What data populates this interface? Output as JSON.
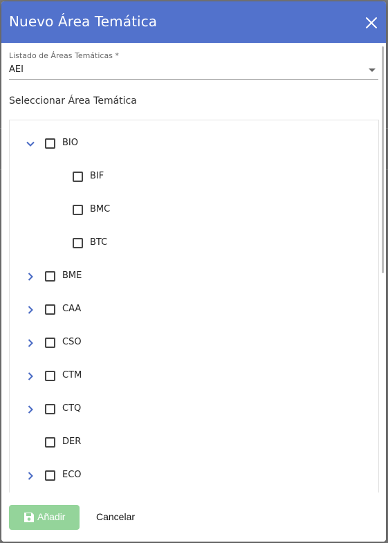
{
  "dialog": {
    "title": "Nuevo Área Temática"
  },
  "field": {
    "label": "Listado de Áreas Temáticas *",
    "value": "AEI"
  },
  "section_title": "Seleccionar Área Temática",
  "tree": {
    "nodes": [
      {
        "label": "BIO",
        "expander": "expanded",
        "level": 0,
        "checked": false
      },
      {
        "label": "BIF",
        "expander": "none",
        "level": 1,
        "checked": false
      },
      {
        "label": "BMC",
        "expander": "none",
        "level": 1,
        "checked": false
      },
      {
        "label": "BTC",
        "expander": "none",
        "level": 1,
        "checked": false
      },
      {
        "label": "BME",
        "expander": "collapsed",
        "level": 0,
        "checked": false
      },
      {
        "label": "CAA",
        "expander": "collapsed",
        "level": 0,
        "checked": false
      },
      {
        "label": "CSO",
        "expander": "collapsed",
        "level": 0,
        "checked": false
      },
      {
        "label": "CTM",
        "expander": "collapsed",
        "level": 0,
        "checked": false
      },
      {
        "label": "CTQ",
        "expander": "collapsed",
        "level": 0,
        "checked": false
      },
      {
        "label": "DER",
        "expander": "none",
        "level": 0,
        "checked": false
      },
      {
        "label": "ECO",
        "expander": "collapsed",
        "level": 0,
        "checked": false
      }
    ]
  },
  "footer": {
    "add_label": "Añadir",
    "cancel_label": "Cancelar"
  },
  "colors": {
    "header": "#5272cc",
    "add_button": "#94d49a",
    "chevron": "#4a6bc4"
  }
}
